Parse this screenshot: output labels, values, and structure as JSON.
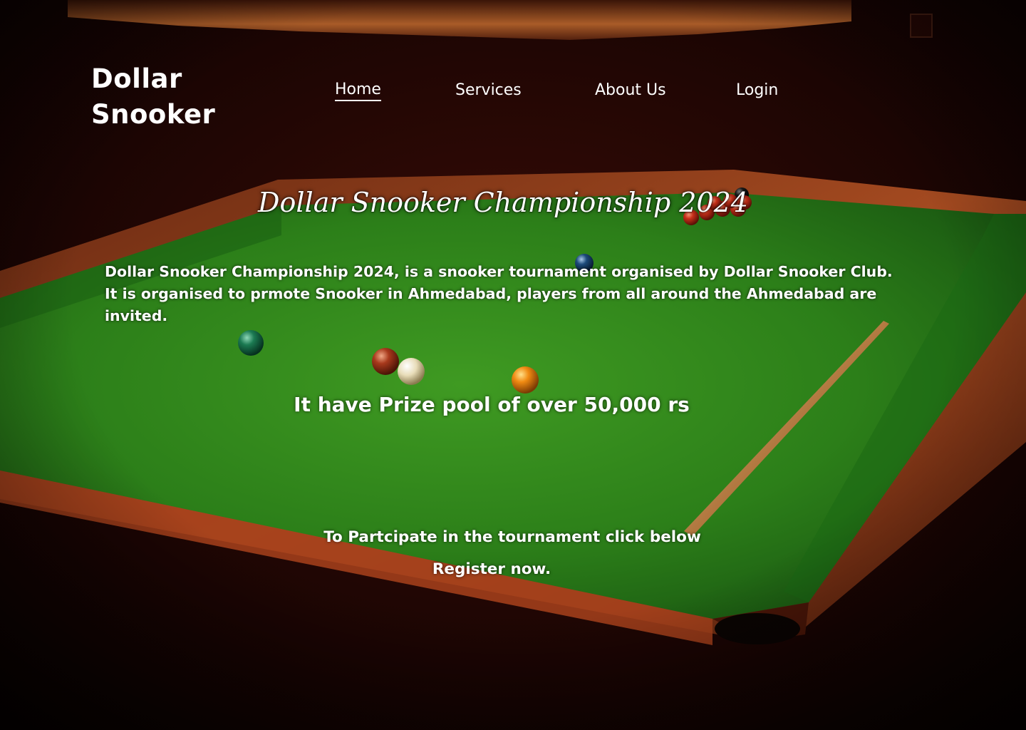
{
  "brand": {
    "line1": "Dollar",
    "line2": "Snooker"
  },
  "nav": {
    "items": [
      {
        "label": "Home",
        "active": true
      },
      {
        "label": "Services",
        "active": false
      },
      {
        "label": "About Us",
        "active": false
      },
      {
        "label": "Login",
        "active": false
      }
    ]
  },
  "hero": {
    "title": "Dollar Snooker Championship 2024",
    "intro": "Dollar Snooker Championship 2024, is a snooker tournament organised by Dollar Snooker Club. It is organised to prmote Snooker in Ahmedabad, players from all around the Ahmedabad are invited.",
    "prize": "It have  Prize pool of over 50,000 rs",
    "participate": "To Partcipate in the tournament click below",
    "register": "Register now."
  },
  "background": {
    "subject": "snooker-table-photo",
    "cloth_color": "#2f8a1e",
    "cushion_color": "#8a3a1c",
    "room_color": "#1a0504"
  }
}
